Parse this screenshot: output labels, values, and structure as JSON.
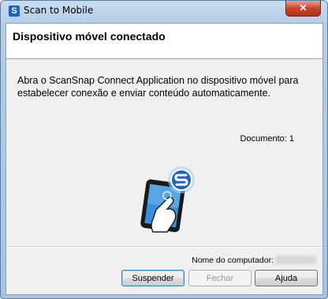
{
  "window": {
    "title": "Scan to Mobile",
    "close_glyph": "✕"
  },
  "header": {
    "title": "Dispositivo móvel conectado"
  },
  "body": {
    "message": "Abra o ScanSnap Connect Application no dispositivo móvel para estabelecer conexão e enviar conteúdo automaticamente.",
    "document_count": "Documento: 1"
  },
  "footer": {
    "computer_label": "Nome do computador:",
    "buttons": {
      "suspend": "Suspender",
      "close": "Fechar",
      "help": "Ajuda"
    }
  },
  "icons": {
    "app": "scan-to-mobile-icon",
    "illustration": "tablet-touch-icon"
  },
  "colors": {
    "accent": "#1b63c6",
    "close_button": "#c9452d"
  }
}
